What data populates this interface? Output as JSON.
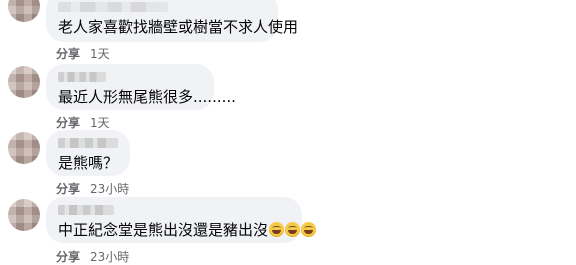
{
  "comments": [
    {
      "text": "老人家喜歡找牆壁或樹當不求人使用",
      "share_label": "分享",
      "time": "1天"
    },
    {
      "text": "最近人形無尾熊很多.........",
      "share_label": "分享",
      "time": "1天"
    },
    {
      "text": "是熊嗎？",
      "share_label": "分享",
      "time": "23小時"
    },
    {
      "text": "中正紀念堂是熊出沒還是豬出沒",
      "emojis": [
        "grinning-face-emoji",
        "grinning-face-emoji",
        "grinning-face-emoji"
      ],
      "share_label": "分享",
      "time": "23小時"
    }
  ],
  "colors": {
    "bubble": "#f0f2f5",
    "meta_text": "#65676b"
  }
}
